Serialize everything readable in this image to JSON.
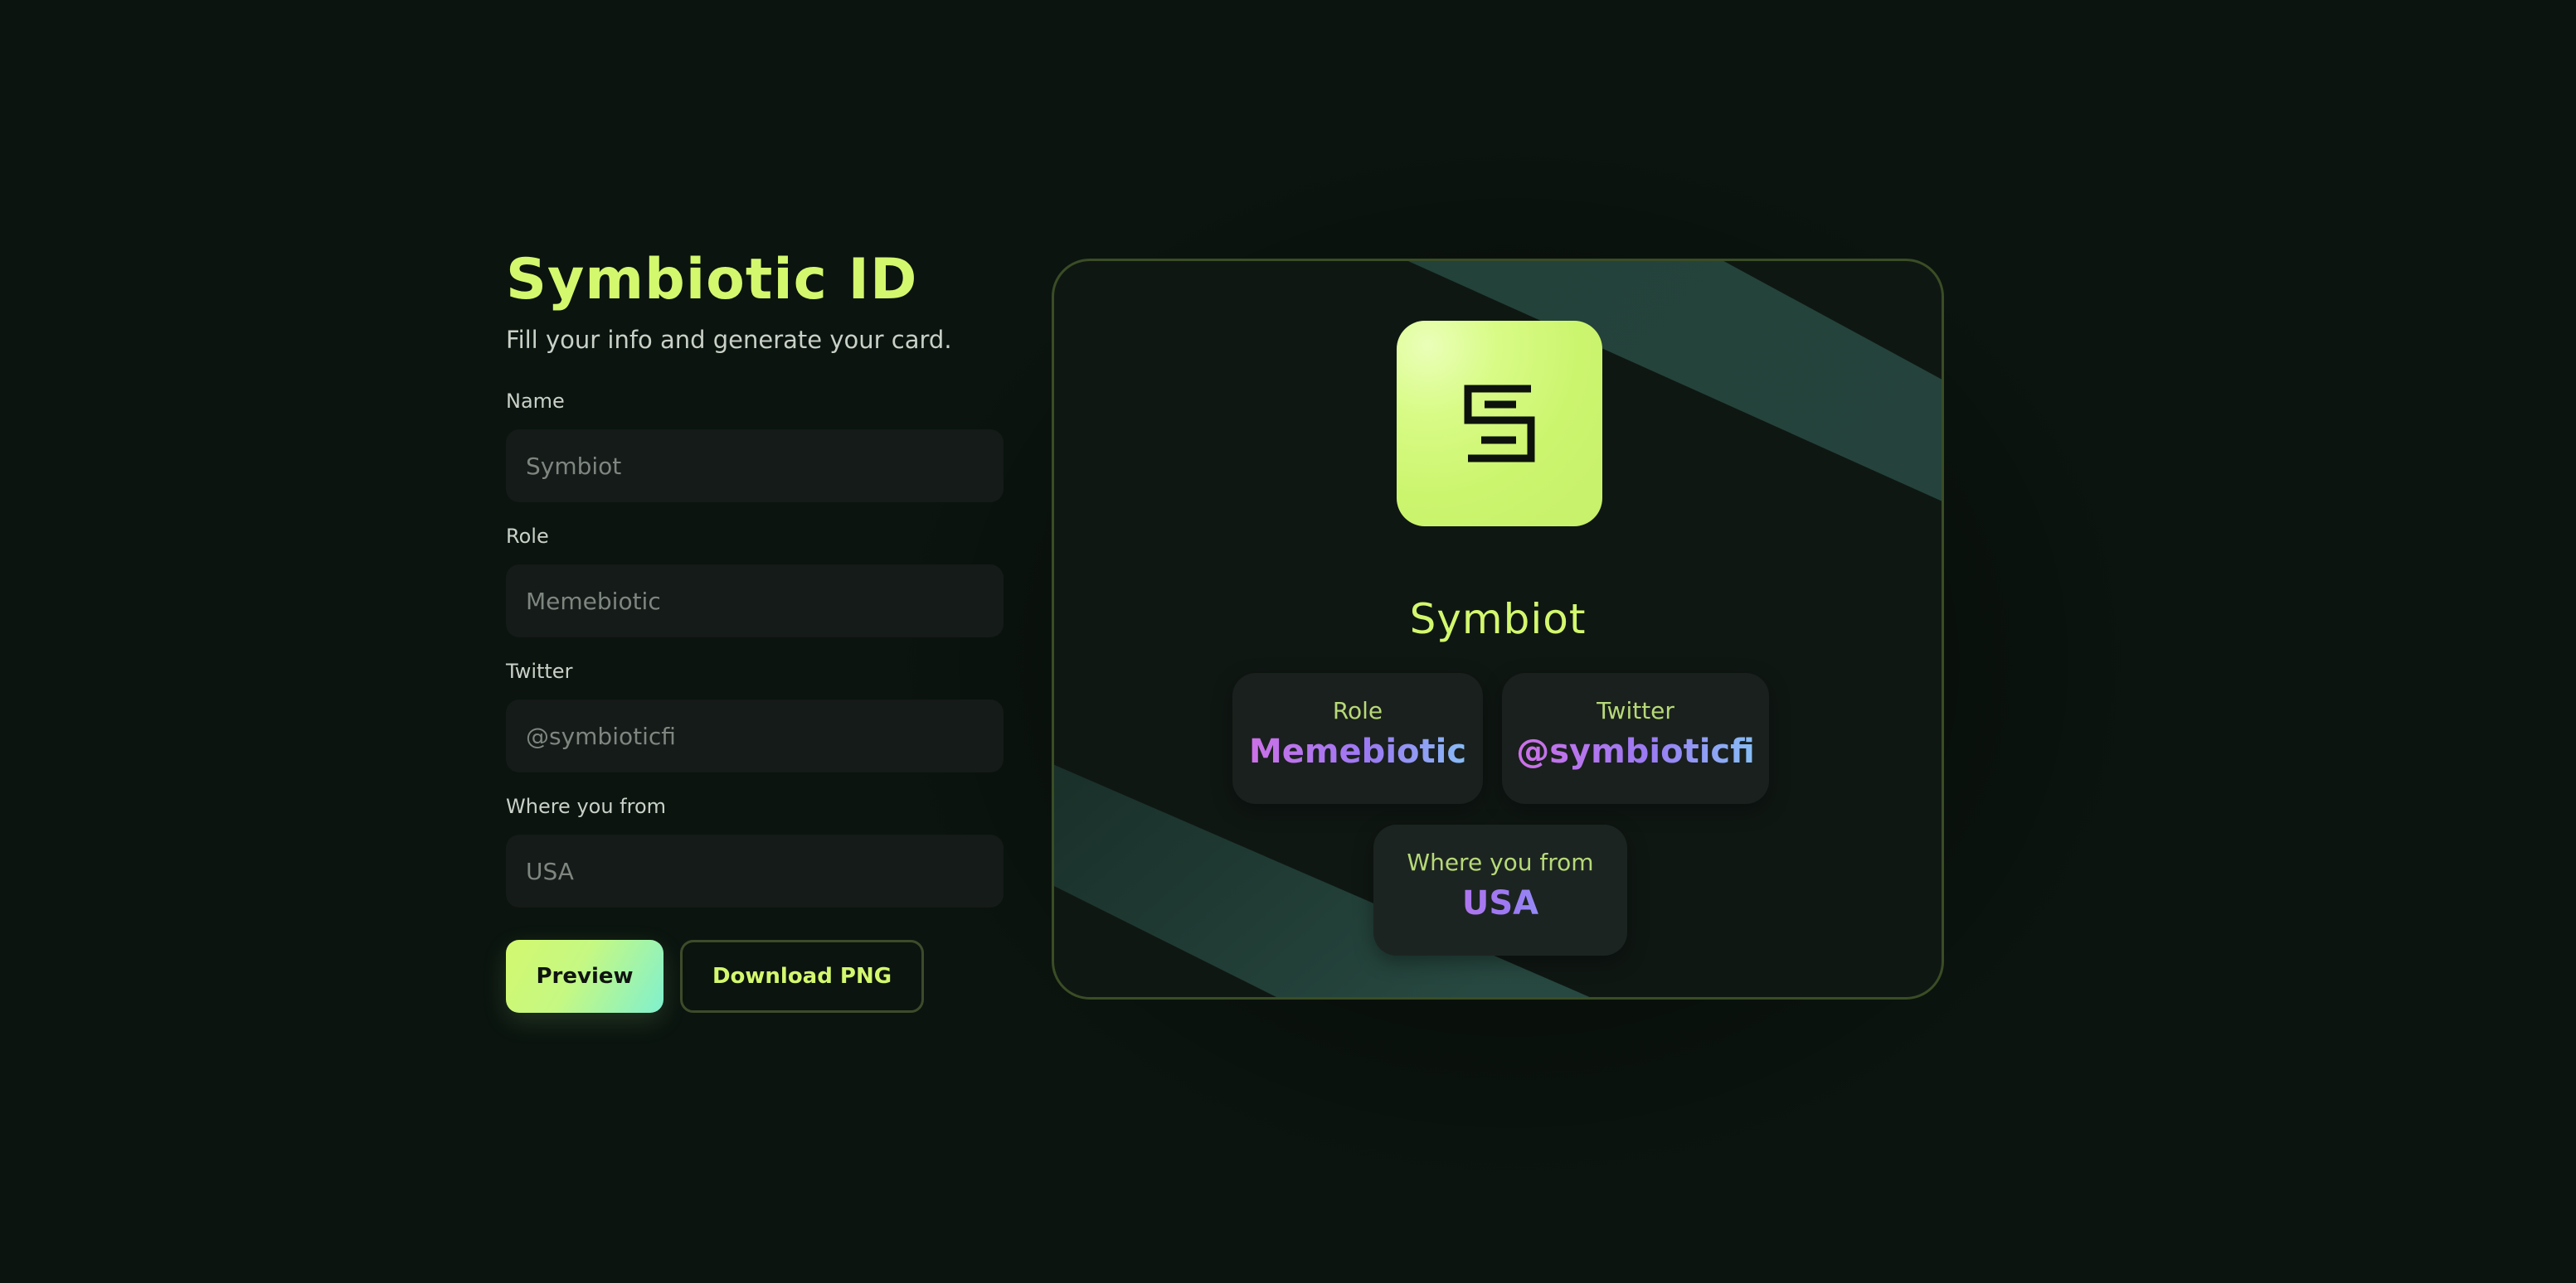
{
  "form": {
    "title": "Symbiotic ID",
    "subtitle": "Fill your info and generate your card.",
    "fields": [
      {
        "label": "Name",
        "placeholder": "Symbiot"
      },
      {
        "label": "Role",
        "placeholder": "Memebiotic"
      },
      {
        "label": "Twitter",
        "placeholder": "@symbioticfi"
      },
      {
        "label": "Where you from",
        "placeholder": "USA"
      }
    ],
    "preview_label": "Preview",
    "download_label": "Download PNG"
  },
  "card": {
    "name": "Symbiot",
    "role_label": "Role",
    "role_value": "Memebiotic",
    "twitter_label": "Twitter",
    "twitter_value": "@symbioticfi",
    "from_label": "Where you from",
    "from_value": "USA",
    "logo_icon": "symbiotic-logo-icon"
  },
  "colors": {
    "background": "#0b140f",
    "accent": "#d3f86e",
    "accent_teal": "#7ff0cf",
    "gradient_text_start": "#d46fe6",
    "gradient_text_end": "#84c8f6"
  }
}
